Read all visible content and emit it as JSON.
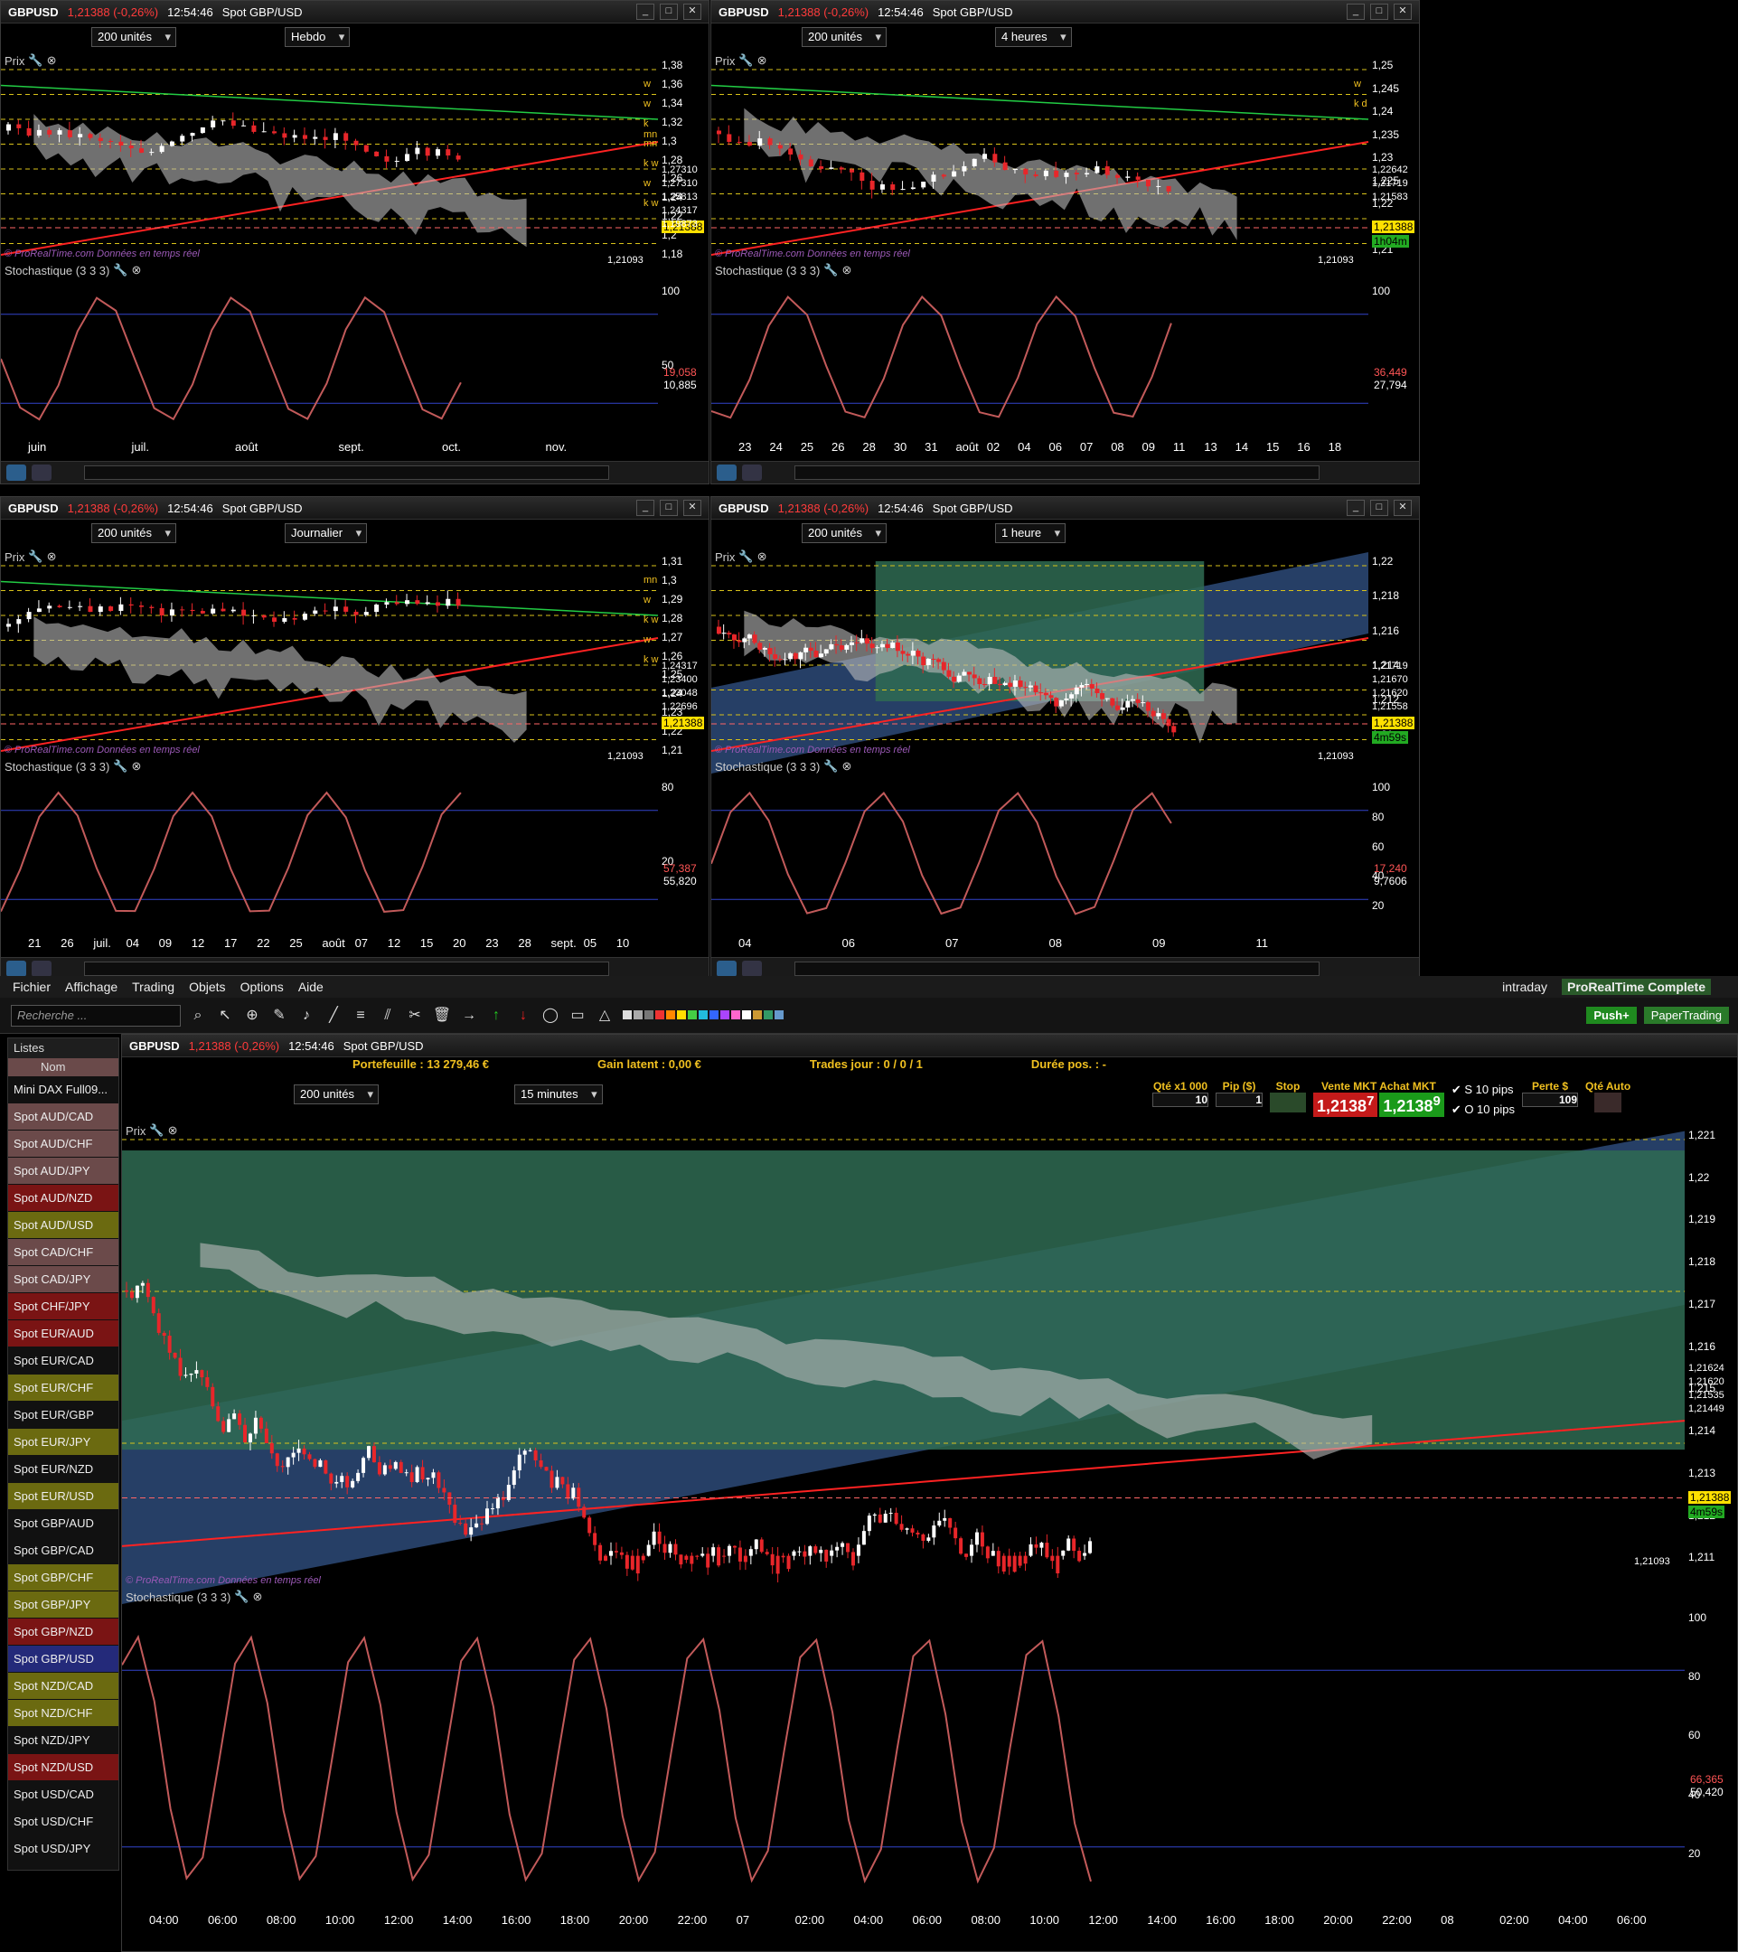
{
  "header": {
    "symbol": "GBPUSD",
    "quote": "1,21388 (-0,26%)",
    "time": "12:54:46",
    "instrument": "Spot GBP/USD"
  },
  "common": {
    "units": "200 unités",
    "prix": "Prix",
    "stochastic": "Stochastique (3 3 3)",
    "watermark": "© ProRealTime.com  Données en temps réel",
    "current_price": "1,21388",
    "ref_level": "1,21093"
  },
  "windows": [
    {
      "id": "w1",
      "timeframe": "Hebdo",
      "y_ticks": [
        "1,38",
        "1,36",
        "1,34",
        "1,32",
        "1,3",
        "1,28",
        "1,26",
        "1,24",
        "1,22",
        "1,2",
        "1,18"
      ],
      "level_labels": [
        "1,27310",
        "1,27310",
        "1,25813",
        "1,24317",
        "1,19873"
      ],
      "stoch_ticks": [
        "100",
        "50"
      ],
      "stoch_values": [
        "19,058",
        "10,885"
      ],
      "x_labels": [
        "juin",
        "juil.",
        "août",
        "sept.",
        "oct.",
        "nov."
      ],
      "line_tags": [
        "w",
        "w",
        "k mn",
        "mn",
        "k w",
        "w",
        "k w"
      ]
    },
    {
      "id": "w2",
      "timeframe": "4 heures",
      "y_ticks": [
        "1,25",
        "1,245",
        "1,24",
        "1,235",
        "1,23",
        "1,225",
        "1,22",
        "1,215",
        "1,21"
      ],
      "level_labels": [
        "1,22642",
        "1,21719",
        "1,21583"
      ],
      "countdown": "1h04m",
      "stoch_ticks": [
        "100"
      ],
      "stoch_values": [
        "36,449",
        "27,794"
      ],
      "x_labels": [
        "23",
        "24",
        "25",
        "26",
        "28",
        "30",
        "31",
        "août",
        "02",
        "04",
        "06",
        "07",
        "08",
        "09",
        "11",
        "13",
        "14",
        "15",
        "16",
        "18"
      ],
      "line_tags": [
        "w",
        "k d"
      ]
    },
    {
      "id": "w3",
      "timeframe": "Journalier",
      "y_ticks": [
        "1,31",
        "1,3",
        "1,29",
        "1,28",
        "1,27",
        "1,26",
        "1,25",
        "1,24",
        "1,23",
        "1,22",
        "1,21"
      ],
      "level_labels": [
        "1,24317",
        "1,23400",
        "1,23048",
        "1,22696"
      ],
      "stoch_ticks": [
        "80",
        "20"
      ],
      "stoch_values": [
        "57,387",
        "55,820"
      ],
      "x_labels": [
        "21",
        "26",
        "juil.",
        "04",
        "09",
        "12",
        "17",
        "22",
        "25",
        "août",
        "07",
        "12",
        "15",
        "20",
        "23",
        "28",
        "sept.",
        "05",
        "10"
      ],
      "line_tags": [
        "mn",
        "w",
        "k w",
        "w",
        "k w"
      ]
    },
    {
      "id": "w4",
      "timeframe": "1 heure",
      "y_ticks": [
        "1,22",
        "1,218",
        "1,216",
        "1,214",
        "1,212",
        "1,21"
      ],
      "level_labels": [
        "1,21719",
        "1,21670",
        "1,21620",
        "1,21558"
      ],
      "countdown": "4m59s",
      "stoch_ticks": [
        "100",
        "80",
        "60",
        "40",
        "20"
      ],
      "stoch_values": [
        "17,240",
        "9,7606"
      ],
      "x_labels": [
        "04",
        "06",
        "07",
        "08",
        "09",
        "11"
      ],
      "line_tags": []
    }
  ],
  "main": {
    "menu": [
      "Fichier",
      "Affichage",
      "Trading",
      "Objets",
      "Options",
      "Aide"
    ],
    "mode": "intraday",
    "brand": "ProRealTime Complete",
    "push_button": "Push+",
    "paper_button": "PaperTrading",
    "search_placeholder": "Recherche ...",
    "portfolio": "Portefeuille : 13 279,46 €",
    "gain": "Gain latent : 0,00 €",
    "trades": "Trades jour : 0 / 0 / 1",
    "duration": "Durée pos. : -",
    "timeframe": "15 minutes",
    "qty_label": "Qté x1 000",
    "qty_value": "10",
    "pip_label": "Pip ($)",
    "pip_value": "1",
    "stop_label": "Stop",
    "sell_label": "Vente MKT",
    "buy_label": "Achat MKT",
    "sell_price": "1,2138",
    "sell_sup": "7",
    "buy_price": "1,2138",
    "buy_sup": "9",
    "s_pips": "10",
    "o_pips": "10",
    "pips_unit": "pips",
    "loss_label": "Perte $",
    "loss_value": "109",
    "auto_label": "Qté Auto",
    "y_ticks": [
      "1,221",
      "1,22",
      "1,219",
      "1,218",
      "1,217",
      "1,216",
      "1,215",
      "1,214",
      "1,213",
      "1,212",
      "1,211"
    ],
    "level_labels": [
      "1,21624",
      "1,21620",
      "1,21535",
      "1,21449"
    ],
    "countdown": "4m59s",
    "stoch_ticks": [
      "100",
      "80",
      "60",
      "40",
      "20"
    ],
    "stoch_values": [
      "66,365",
      "50,420"
    ],
    "x_labels": [
      "04:00",
      "06:00",
      "08:00",
      "10:00",
      "12:00",
      "14:00",
      "16:00",
      "18:00",
      "20:00",
      "22:00",
      "07",
      "02:00",
      "04:00",
      "06:00",
      "08:00",
      "10:00",
      "12:00",
      "14:00",
      "16:00",
      "18:00",
      "20:00",
      "22:00",
      "08",
      "02:00",
      "04:00",
      "06:00"
    ]
  },
  "sidebar": {
    "title": "Listes",
    "column": "Nom",
    "items": [
      {
        "label": "Mini DAX Full09...",
        "color": "#111111"
      },
      {
        "label": "Spot AUD/CAD",
        "color": "#6b4a4a"
      },
      {
        "label": "Spot AUD/CHF",
        "color": "#6b4a4a"
      },
      {
        "label": "Spot AUD/JPY",
        "color": "#6b4a4a"
      },
      {
        "label": "Spot AUD/NZD",
        "color": "#7a1414"
      },
      {
        "label": "Spot AUD/USD",
        "color": "#6b6a10"
      },
      {
        "label": "Spot CAD/CHF",
        "color": "#6b4a4a"
      },
      {
        "label": "Spot CAD/JPY",
        "color": "#6b4a4a"
      },
      {
        "label": "Spot CHF/JPY",
        "color": "#7a1414"
      },
      {
        "label": "Spot EUR/AUD",
        "color": "#7a1414"
      },
      {
        "label": "Spot EUR/CAD",
        "color": "#111111"
      },
      {
        "label": "Spot EUR/CHF",
        "color": "#6b6a10"
      },
      {
        "label": "Spot EUR/GBP",
        "color": "#111111"
      },
      {
        "label": "Spot EUR/JPY",
        "color": "#6b6a10"
      },
      {
        "label": "Spot EUR/NZD",
        "color": "#111111"
      },
      {
        "label": "Spot EUR/USD",
        "color": "#6b6a10"
      },
      {
        "label": "Spot GBP/AUD",
        "color": "#111111"
      },
      {
        "label": "Spot GBP/CAD",
        "color": "#111111"
      },
      {
        "label": "Spot GBP/CHF",
        "color": "#6b6a10"
      },
      {
        "label": "Spot GBP/JPY",
        "color": "#6b6a10"
      },
      {
        "label": "Spot GBP/NZD",
        "color": "#7a1414"
      },
      {
        "label": "Spot GBP/USD",
        "color": "#242a7a"
      },
      {
        "label": "Spot NZD/CAD",
        "color": "#6b6a10"
      },
      {
        "label": "Spot NZD/CHF",
        "color": "#6b6a10"
      },
      {
        "label": "Spot NZD/JPY",
        "color": "#111111"
      },
      {
        "label": "Spot NZD/USD",
        "color": "#7a1414"
      },
      {
        "label": "Spot USD/CAD",
        "color": "#111111"
      },
      {
        "label": "Spot USD/CHF",
        "color": "#111111"
      },
      {
        "label": "Spot USD/JPY",
        "color": "#111111"
      }
    ]
  },
  "colors": {
    "bull": "#ffffff",
    "bear": "#e8262a",
    "level": "#d8c21a",
    "channel_fill": "#2f4f7f",
    "zone_fill": "#2f6b52",
    "price_tag": "#ffe000",
    "countdown": "#22aa22"
  }
}
